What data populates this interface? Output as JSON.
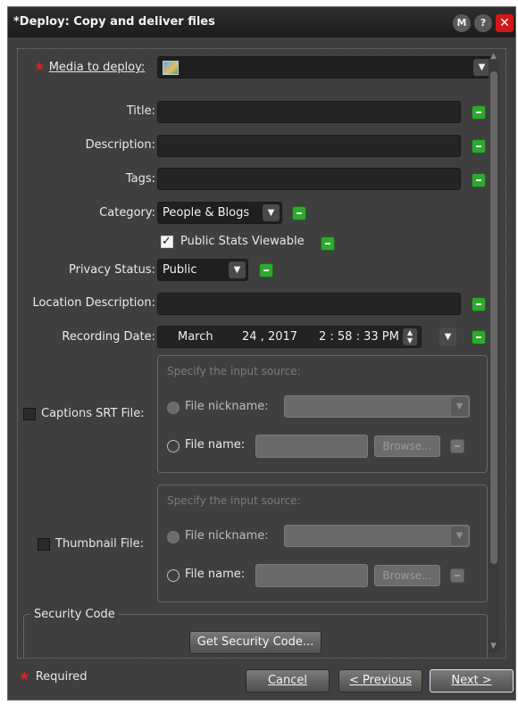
{
  "window": {
    "title": "*Deploy: Copy and deliver files",
    "help_m": "M",
    "help_q": "?",
    "close": "✕"
  },
  "form": {
    "media_label": "Media to deploy:",
    "title_label": "Title:",
    "description_label": "Description:",
    "tags_label": "Tags:",
    "category_label": "Category:",
    "category_value": "People & Blogs",
    "public_stats_label": "Public Stats Viewable",
    "privacy_label": "Privacy Status:",
    "privacy_value": "Public",
    "location_label": "Location Description:",
    "recording_date_label": "Recording Date:",
    "recording_month": "March",
    "recording_day": "24 , 2017",
    "recording_time": "2 : 58 : 33  PM"
  },
  "captions": {
    "label": "Captions SRT File:",
    "hint": "Specify the input source:",
    "nickname_label": "File nickname:",
    "filename_label": "File name:",
    "browse_label": "Browse..."
  },
  "thumbnail": {
    "label": "Thumbnail File:",
    "hint": "Specify the input source:",
    "nickname_label": "File nickname:",
    "filename_label": "File name:",
    "browse_label": "Browse..."
  },
  "security": {
    "group_label": "Security Code",
    "button_label": "Get Security Code..."
  },
  "footer": {
    "required_label": "Required",
    "cancel_label": "Cancel",
    "previous_label": "< Previous",
    "next_label": "Next >"
  },
  "icons": {
    "required_star": "★",
    "dropdown": "chevron-down-icon",
    "spinner": "spinner-icon",
    "media": "media-file-icon"
  },
  "colors": {
    "background": "#3f3f3f",
    "title_bar": "#1c1c1c",
    "field": "#252525",
    "green_button": "#2fa82f",
    "required_star": "#e02020",
    "close_button": "#d01818"
  }
}
